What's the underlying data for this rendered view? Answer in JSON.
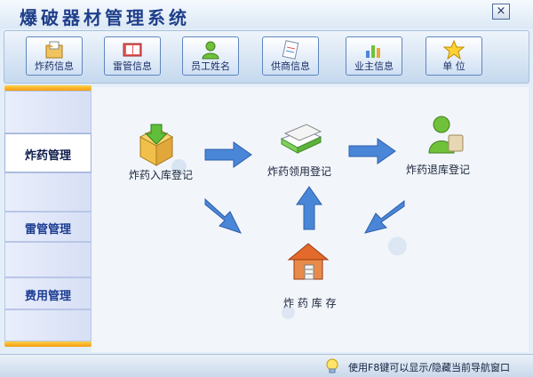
{
  "window": {
    "title": "爆破器材管理系统",
    "close_label": "×"
  },
  "toolbar": {
    "buttons": [
      {
        "label": "炸药信息",
        "icon": "folder-explosive-icon"
      },
      {
        "label": "雷管信息",
        "icon": "book-icon"
      },
      {
        "label": "员工姓名",
        "icon": "user-icon"
      },
      {
        "label": "供商信息",
        "icon": "document-icon"
      },
      {
        "label": "业主信息",
        "icon": "chart-icon"
      },
      {
        "label": "单    位",
        "icon": "star-icon"
      }
    ]
  },
  "sidebar": {
    "items": [
      {
        "label": "",
        "active": false
      },
      {
        "label": "炸药管理",
        "active": true
      },
      {
        "label": "",
        "active": false
      },
      {
        "label": "雷管管理",
        "active": false
      },
      {
        "label": "",
        "active": false
      },
      {
        "label": "费用管理",
        "active": false
      }
    ]
  },
  "flow": {
    "nodes": [
      {
        "label": "炸药入库登记",
        "icon": "box-down-icon"
      },
      {
        "label": "炸药领用登记",
        "icon": "books-icon"
      },
      {
        "label": "炸药退库登记",
        "icon": "user-bag-icon"
      },
      {
        "label": "炸 药 库 存",
        "icon": "house-icon"
      }
    ]
  },
  "status": {
    "text": "使用F8键可以显示/隐藏当前导航窗口"
  },
  "colors": {
    "title": "#1f3f8a",
    "accent": "#ffd24a",
    "arrow": "#4a86d8"
  }
}
